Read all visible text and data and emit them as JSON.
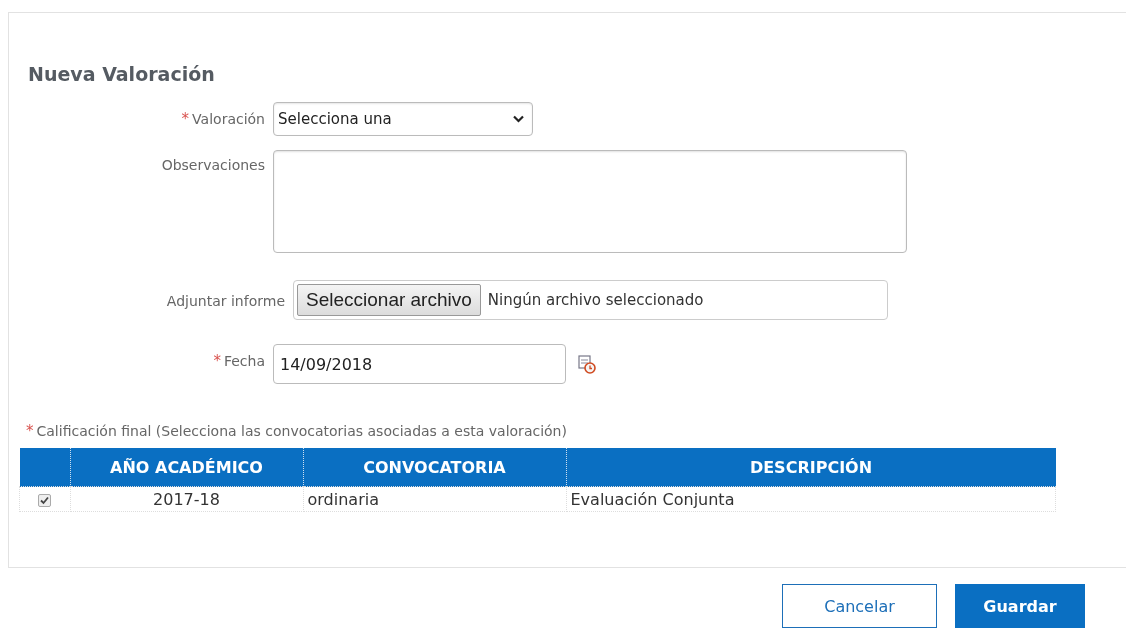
{
  "title": "Nueva Valoración",
  "fields": [
    {
      "kind": "select",
      "label": "Valoración",
      "required_mark": "*",
      "value": "Selecciona una"
    },
    {
      "kind": "textarea",
      "label": "Observaciones"
    },
    {
      "kind": "file",
      "label": "Adjuntar informe",
      "button": "Seleccionar archivo",
      "value": "Ningún archivo seleccionado"
    },
    {
      "kind": "date",
      "label": "Fecha",
      "required_mark": "*",
      "value": "14/09/2018"
    }
  ],
  "grades": {
    "required_mark": "*",
    "label": "Calificación final (Selecciona las convocatorias asociadas a esta valoración)",
    "columns": [
      "AÑO ACADÉMICO",
      "CONVOCATORIA",
      "DESCRIPCIÓN"
    ],
    "rows": [
      {
        "checked": true,
        "cells": [
          "2017-18",
          "ordinaria",
          "Evaluación Conjunta"
        ]
      }
    ]
  },
  "buttons": [
    {
      "kind": "secondary",
      "label": "Cancelar"
    },
    {
      "kind": "primary",
      "label": "Guardar"
    }
  ]
}
